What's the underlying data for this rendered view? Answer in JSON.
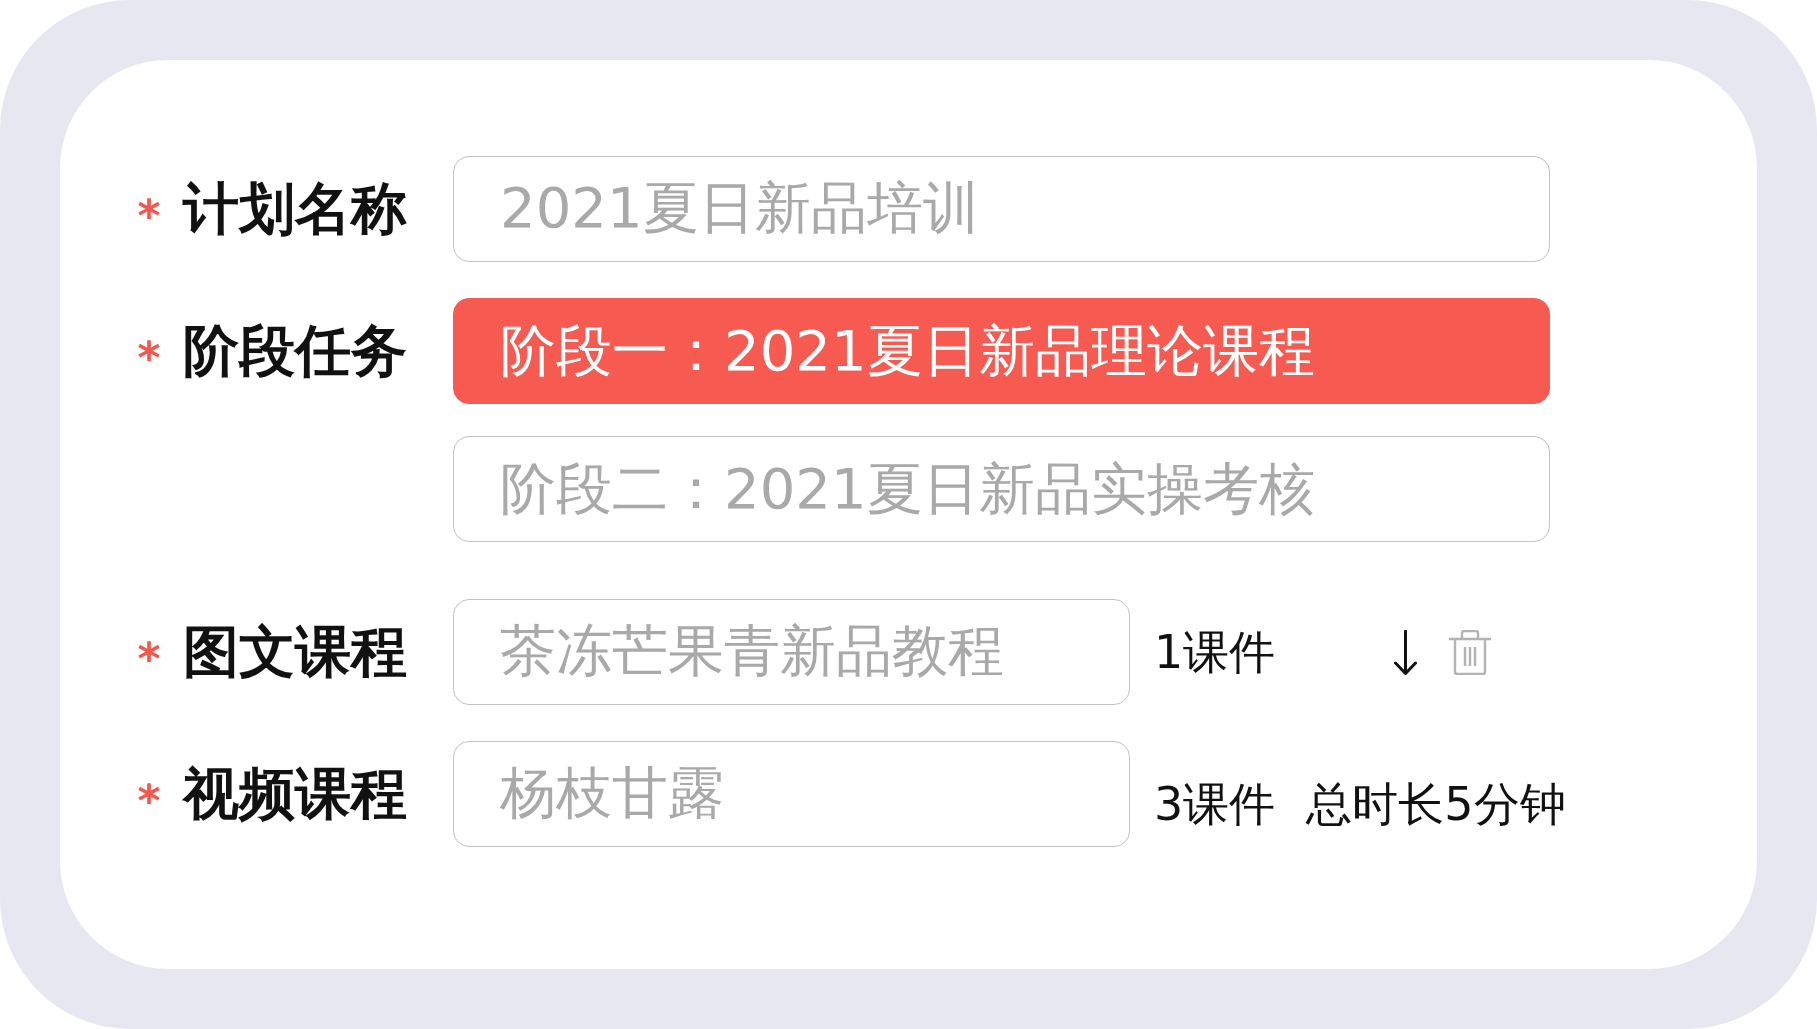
{
  "form": {
    "rows": [
      {
        "kind": "input",
        "mark": "*",
        "label": "计划名称",
        "value": "2021夏日新品培训"
      },
      {
        "kind": "stages",
        "mark": "*",
        "label": "阶段任务",
        "stages": [
          {
            "text": "阶段一：2021夏日新品理论课程",
            "selected": true
          },
          {
            "text": "阶段二：2021夏日新品实操考核",
            "selected": false
          }
        ]
      },
      {
        "kind": "course",
        "mark": "*",
        "label": "图文课程",
        "value": "茶冻芒果青新品教程",
        "count": "1课件",
        "actions": [
          {
            "kind": "move_down",
            "disabled": false
          },
          {
            "kind": "delete",
            "disabled": true
          }
        ]
      },
      {
        "kind": "course",
        "mark": "*",
        "label": "视频课程",
        "value": "杨枝甘露",
        "count": "3课件",
        "duration": "总时长5分钟"
      }
    ]
  }
}
